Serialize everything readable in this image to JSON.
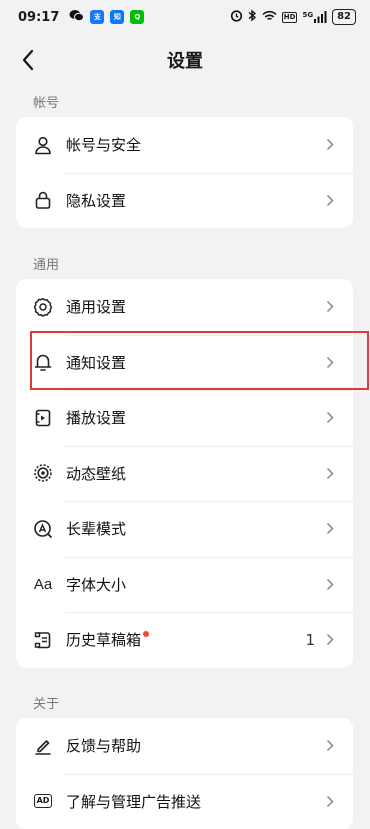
{
  "status_bar": {
    "time": "09:17",
    "apps": [
      {
        "name": "wechat-icon",
        "color": "#07c160"
      },
      {
        "name": "alipay-icon",
        "color": "#1677ff"
      },
      {
        "name": "zhihu-icon",
        "color": "#0b78f6",
        "text": "知乎"
      },
      {
        "name": "iqiyi-icon",
        "color": "#00be06",
        "text": "iQIYI"
      }
    ],
    "network_label": "5G",
    "hd_label": "HD",
    "battery": "82"
  },
  "header": {
    "title": "设置"
  },
  "sections": {
    "account": {
      "label": "帐号",
      "items": [
        {
          "label": "帐号与安全"
        },
        {
          "label": "隐私设置"
        }
      ]
    },
    "general": {
      "label": "通用",
      "items": [
        {
          "label": "通用设置"
        },
        {
          "label": "通知设置"
        },
        {
          "label": "播放设置"
        },
        {
          "label": "动态壁纸"
        },
        {
          "label": "长辈模式"
        },
        {
          "label": "字体大小",
          "icon_text": "Aa"
        },
        {
          "label": "历史草稿箱",
          "value": "1",
          "has_dot": true
        }
      ]
    },
    "about": {
      "label": "关于",
      "items": [
        {
          "label": "反馈与帮助"
        },
        {
          "label": "了解与管理广告推送",
          "icon_text": "AD"
        }
      ]
    }
  },
  "colors": {
    "background": "#f2f2f4",
    "card": "#ffffff",
    "highlight": "#e23a3a",
    "red_dot": "#f0483e"
  }
}
